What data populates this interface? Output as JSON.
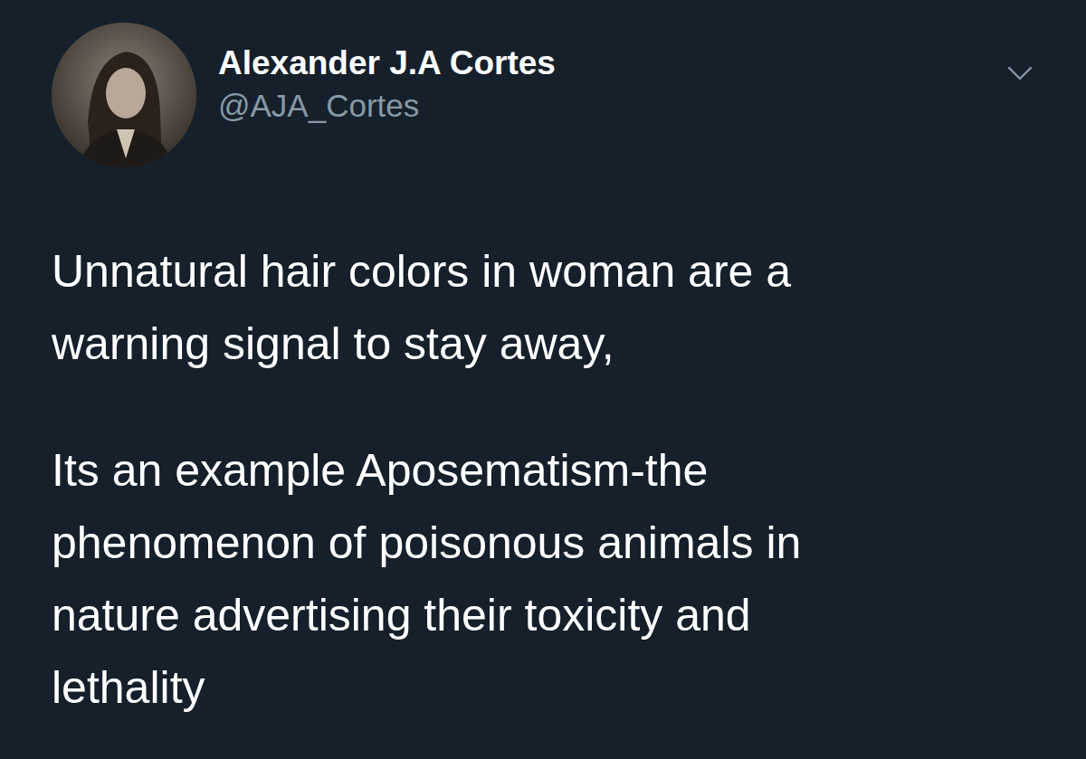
{
  "author": {
    "name": "Alexander J.A Cortes",
    "handle": "@AJA_Cortes"
  },
  "paragraphs": [
    [
      "Unnatural hair colors in woman are a",
      "warning signal to stay away,"
    ],
    [
      "Its an example Aposematism-the",
      "phenomenon of poisonous animals in",
      "nature advertising their toxicity and",
      "lethality"
    ]
  ]
}
